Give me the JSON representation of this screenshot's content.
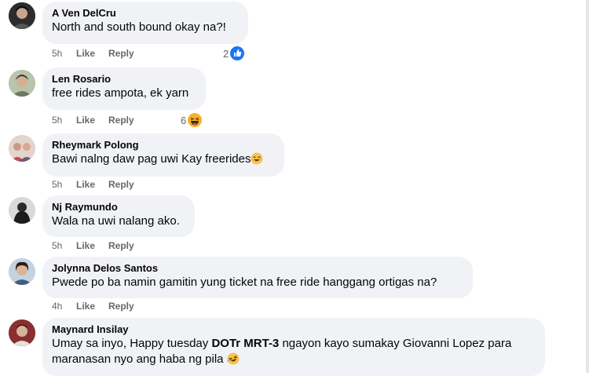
{
  "comments": [
    {
      "author": "A Ven DelCru",
      "text": "North and south bound okay na?!",
      "time": "5h",
      "like": "Like",
      "reply": "Reply",
      "reaction_count": "2",
      "reaction_icon": "like-icon"
    },
    {
      "author": "Len Rosario",
      "text": "free rides ampota, ek yarn",
      "time": "5h",
      "like": "Like",
      "reply": "Reply",
      "reaction_count": "6",
      "reaction_icon": "haha-icon"
    },
    {
      "author": "Rheymark Polong",
      "text": "Bawi nalng daw pag uwi Kay freerides",
      "emoji": "smile-icon",
      "time": "5h",
      "like": "Like",
      "reply": "Reply"
    },
    {
      "author": "Nj Raymundo",
      "text": "Wala na uwi nalang ako.",
      "time": "5h",
      "like": "Like",
      "reply": "Reply"
    },
    {
      "author": "Jolynna Delos Santos",
      "text": "Pwede po ba namin gamitin yung ticket na free ride hanggang ortigas na?",
      "time": "4h",
      "like": "Like",
      "reply": "Reply"
    },
    {
      "author": "Maynard Insilay",
      "text_before": "Umay sa inyo, Happy tuesday ",
      "mention": "DOTr MRT-3",
      "text_after": " ngayon kayo sumakay Giovanni Lopez para maranasan nyo ang haba ng pila",
      "emoji": "laughing-icon"
    }
  ],
  "colors": {
    "bubble": "#f0f2f5",
    "meta": "#65676b",
    "like_blue": "#1877f2",
    "haha_yellow": "#f7b125"
  }
}
